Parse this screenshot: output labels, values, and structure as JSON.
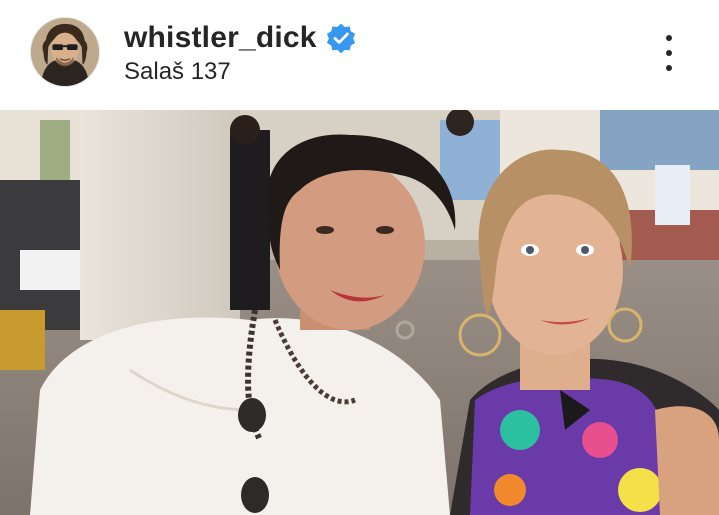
{
  "post": {
    "username": "whistler_dick",
    "verified": true,
    "location": "Salaš 137"
  },
  "icons": {
    "verified": "verified-badge-icon",
    "more": "more-options-vertical-icon"
  },
  "colors": {
    "text": "#262626",
    "verified_blue": "#3897f0",
    "background": "#ffffff"
  }
}
